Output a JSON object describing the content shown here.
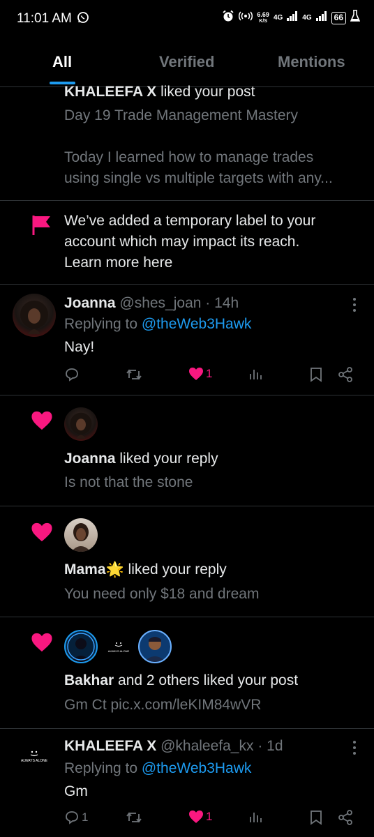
{
  "status": {
    "time": "11:01 AM",
    "speed_value": "6.69",
    "speed_unit": "K/S",
    "net1": "4G",
    "net2": "4G",
    "battery": "66"
  },
  "tabs": [
    {
      "label": "All",
      "active": true
    },
    {
      "label": "Verified",
      "active": false
    },
    {
      "label": "Mentions",
      "active": false
    }
  ],
  "notifications": {
    "n1": {
      "actor": "KHALEEFA X",
      "action": " liked your post",
      "line1": "Day 19 Trade Management Mastery",
      "line2": "Today I learned how to manage trades",
      "line3": "using single vs multiple targets with any..."
    },
    "n2": {
      "line1": "We’ve added a temporary label to your",
      "line2": "account which may impact its reach.",
      "line3": "Learn more here"
    },
    "n3": {
      "name": "Joanna",
      "handle": "@shes_joan",
      "sep": "·",
      "time": "14h",
      "replying_prefix": "Replying to ",
      "replying_to": "@theWeb3Hawk",
      "text": "Nay!",
      "likes": "1"
    },
    "n4": {
      "actor": "Joanna",
      "action": " liked your reply",
      "text": "Is not that the stone"
    },
    "n5": {
      "actor": "Mama",
      "emoji": "🌟",
      "action": " liked your reply",
      "text": "You need only $18 and dream"
    },
    "n6": {
      "actor": "Bakhar",
      "action": " and 2 others liked your post",
      "text": "Gm Ct pic.x.com/leKIM84wVR",
      "mini_logo_text": "ALWAYS ALONE"
    },
    "n7": {
      "name": "KHALEEFA X",
      "handle": "@khaleefa_kx",
      "sep": "·",
      "time": "1d",
      "replying_prefix": "Replying to ",
      "replying_to": "@theWeb3Hawk",
      "text": "Gm",
      "replies": "1",
      "likes": "1",
      "logo_text": "ALWAYS ALONE"
    }
  },
  "colors": {
    "background": "#000000",
    "accent_blue": "#1d9bf0",
    "like_pink": "#f91880",
    "muted_gray": "#71767b",
    "divider": "#2f3336"
  }
}
